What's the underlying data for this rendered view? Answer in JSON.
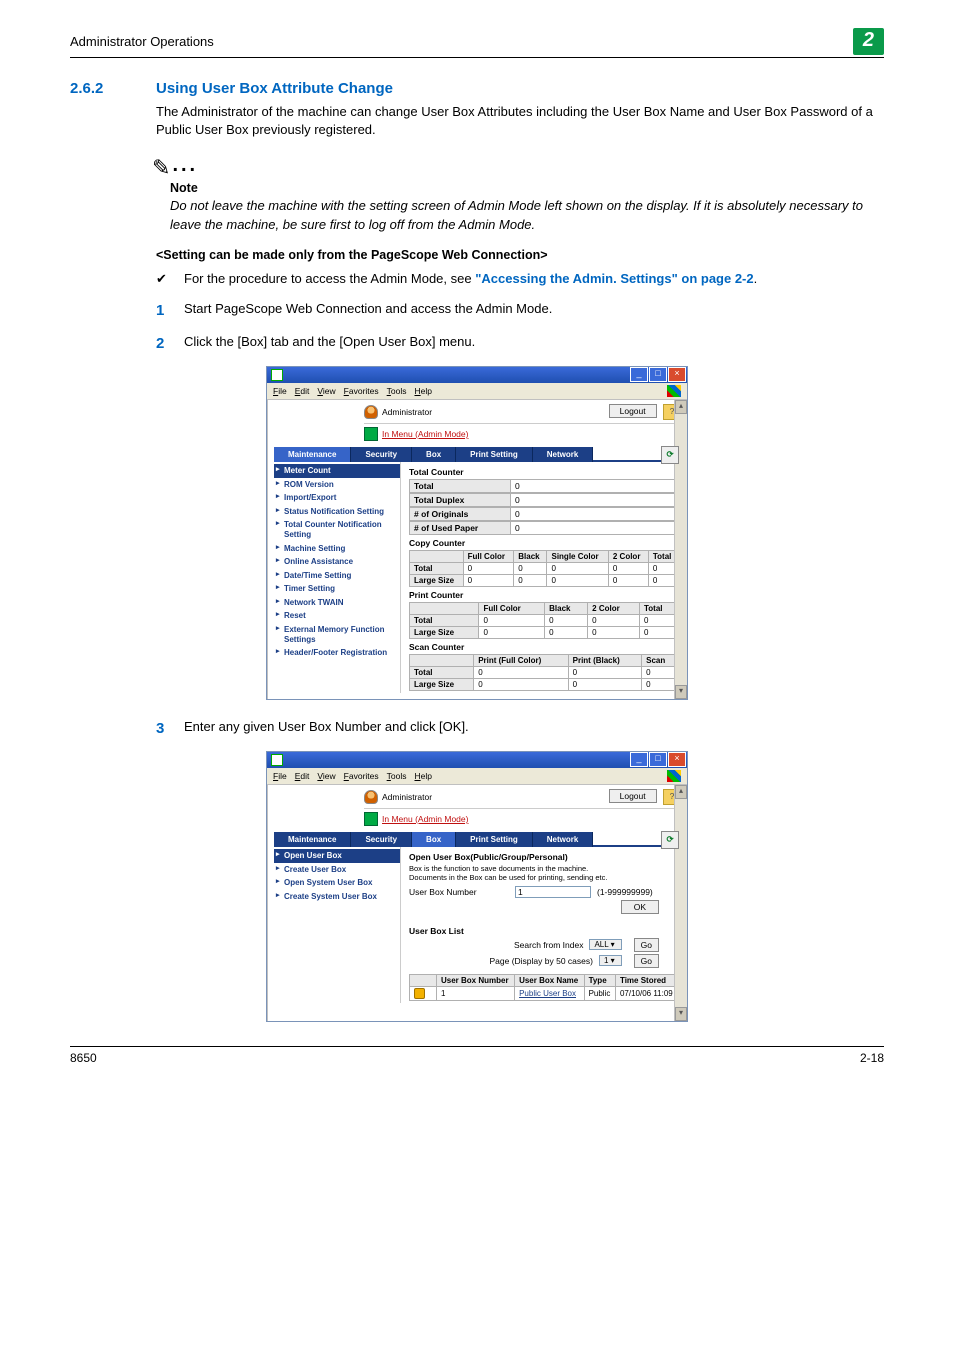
{
  "header": {
    "running_title": "Administrator Operations",
    "chapter_number": "2"
  },
  "section": {
    "number": "2.6.2",
    "title": "Using User Box Attribute Change",
    "intro": "The Administrator of the machine can change User Box Attributes including the User Box Name and User Box Password of a Public User Box previously registered."
  },
  "note": {
    "label": "Note",
    "text": "Do not leave the machine with the setting screen of Admin Mode left shown on the display. If it is absolutely necessary to leave the machine, be sure first to log off from the Admin Mode."
  },
  "subhead": "<Setting can be made only from the PageScope Web Connection>",
  "bullet": {
    "text_before": "For the procedure to access the Admin Mode, see ",
    "xref": "\"Accessing the Admin. Settings\" on page 2-2",
    "text_after": "."
  },
  "steps": {
    "s1": {
      "num": "1",
      "text": "Start PageScope Web Connection and access the Admin Mode."
    },
    "s2": {
      "num": "2",
      "text": "Click the [Box] tab and the [Open User Box] menu."
    },
    "s3": {
      "num": "3",
      "text": "Enter any given User Box Number and click [OK]."
    }
  },
  "browser": {
    "menu": {
      "file": "File",
      "edit": "Edit",
      "view": "View",
      "favorites": "Favorites",
      "tools": "Tools",
      "help": "Help"
    },
    "logout": "Logout",
    "help_q": "?",
    "admin_label": "Administrator",
    "mode_label": "In Menu (Admin Mode)",
    "refresh": "⟳"
  },
  "tabs": {
    "maintenance": "Maintenance",
    "security": "Security",
    "box": "Box",
    "print_setting": "Print Setting",
    "network": "Network"
  },
  "shot1": {
    "side": [
      "Meter Count",
      "ROM Version",
      "Import/Export",
      "Status Notification Setting",
      "Total Counter Notification Setting",
      "Machine Setting",
      "Online Assistance",
      "Date/Time Setting",
      "Timer Setting",
      "Network TWAIN",
      "Reset",
      "External Memory Function Settings",
      "Header/Footer Registration"
    ],
    "total_counter": {
      "heading": "Total Counter",
      "rows": [
        {
          "k": "Total",
          "v": "0"
        },
        {
          "k": "Total Duplex",
          "v": "0"
        },
        {
          "k": "# of Originals",
          "v": "0"
        },
        {
          "k": "# of Used Paper",
          "v": "0"
        }
      ]
    },
    "copy_counter": {
      "heading": "Copy Counter",
      "cols": [
        "",
        "Full Color",
        "Black",
        "Single Color",
        "2 Color",
        "Total"
      ],
      "rows": [
        {
          "k": "Total",
          "v": [
            "0",
            "0",
            "0",
            "0",
            "0"
          ]
        },
        {
          "k": "Large Size",
          "v": [
            "0",
            "0",
            "0",
            "0",
            "0"
          ]
        }
      ]
    },
    "print_counter": {
      "heading": "Print Counter",
      "cols": [
        "",
        "Full Color",
        "Black",
        "2 Color",
        "Total"
      ],
      "rows": [
        {
          "k": "Total",
          "v": [
            "0",
            "0",
            "0",
            "0"
          ]
        },
        {
          "k": "Large Size",
          "v": [
            "0",
            "0",
            "0",
            "0"
          ]
        }
      ]
    },
    "scan_counter": {
      "heading": "Scan Counter",
      "cols": [
        "",
        "Print (Full Color)",
        "Print (Black)",
        "Scan"
      ],
      "rows": [
        {
          "k": "Total",
          "v": [
            "0",
            "0",
            "0"
          ]
        },
        {
          "k": "Large Size",
          "v": [
            "0",
            "0",
            "0"
          ]
        }
      ]
    }
  },
  "shot2": {
    "side": [
      "Open User Box",
      "Create User Box",
      "Open System User Box",
      "Create System User Box"
    ],
    "panel_heading": "Open User Box(Public/Group/Personal)",
    "panel_desc1": "Box is the function to save documents in the machine.",
    "panel_desc2": "Documents in the Box can be used for printing, sending etc.",
    "user_box_number_label": "User Box Number",
    "user_box_number_value": "1",
    "user_box_number_range": "(1-999999999)",
    "ok": "OK",
    "list_heading": "User Box List",
    "search_label": "Search from Index",
    "search_value": "ALL",
    "page_label": "Page (Display by 50 cases)",
    "page_value": "1",
    "go": "Go",
    "table": {
      "cols": [
        "User Box Number",
        "User Box Name",
        "Type",
        "Time Stored"
      ],
      "row": {
        "num": "1",
        "name": "Public User Box",
        "type": "Public",
        "time": "07/10/06 11:09"
      }
    }
  },
  "footer": {
    "left": "8650",
    "right": "2-18"
  }
}
